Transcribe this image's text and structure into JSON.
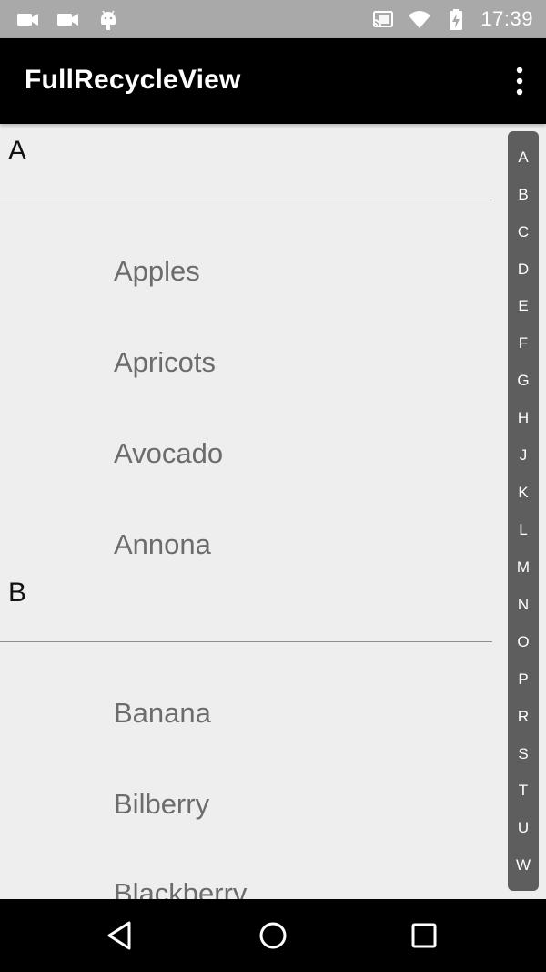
{
  "status_bar": {
    "time": "17:39",
    "left_icons": [
      "video-camera-icon",
      "video-camera-icon",
      "android-icon"
    ],
    "right_icons": [
      "cast-icon",
      "wifi-icon",
      "battery-charging-icon"
    ]
  },
  "app_bar": {
    "title": "FullRecycleView",
    "menu_icon": "overflow-menu-icon"
  },
  "sections": [
    {
      "header": "A",
      "items": [
        "Apples",
        "Apricots",
        "Avocado",
        "Annona"
      ]
    },
    {
      "header": "B",
      "items": [
        "Banana",
        "Bilberry",
        "Blackberry"
      ]
    }
  ],
  "index_bar": {
    "letters": [
      "A",
      "B",
      "C",
      "D",
      "E",
      "F",
      "G",
      "H",
      "J",
      "K",
      "L",
      "M",
      "N",
      "O",
      "P",
      "R",
      "S",
      "T",
      "U",
      "W"
    ]
  },
  "nav_bar": {
    "buttons": [
      "back-icon",
      "home-icon",
      "recents-icon"
    ]
  },
  "colors": {
    "background": "#efeeef",
    "app_bar": "#000000",
    "status_bar": "#a9a9a9",
    "index_bar": "#5e5e5e"
  }
}
